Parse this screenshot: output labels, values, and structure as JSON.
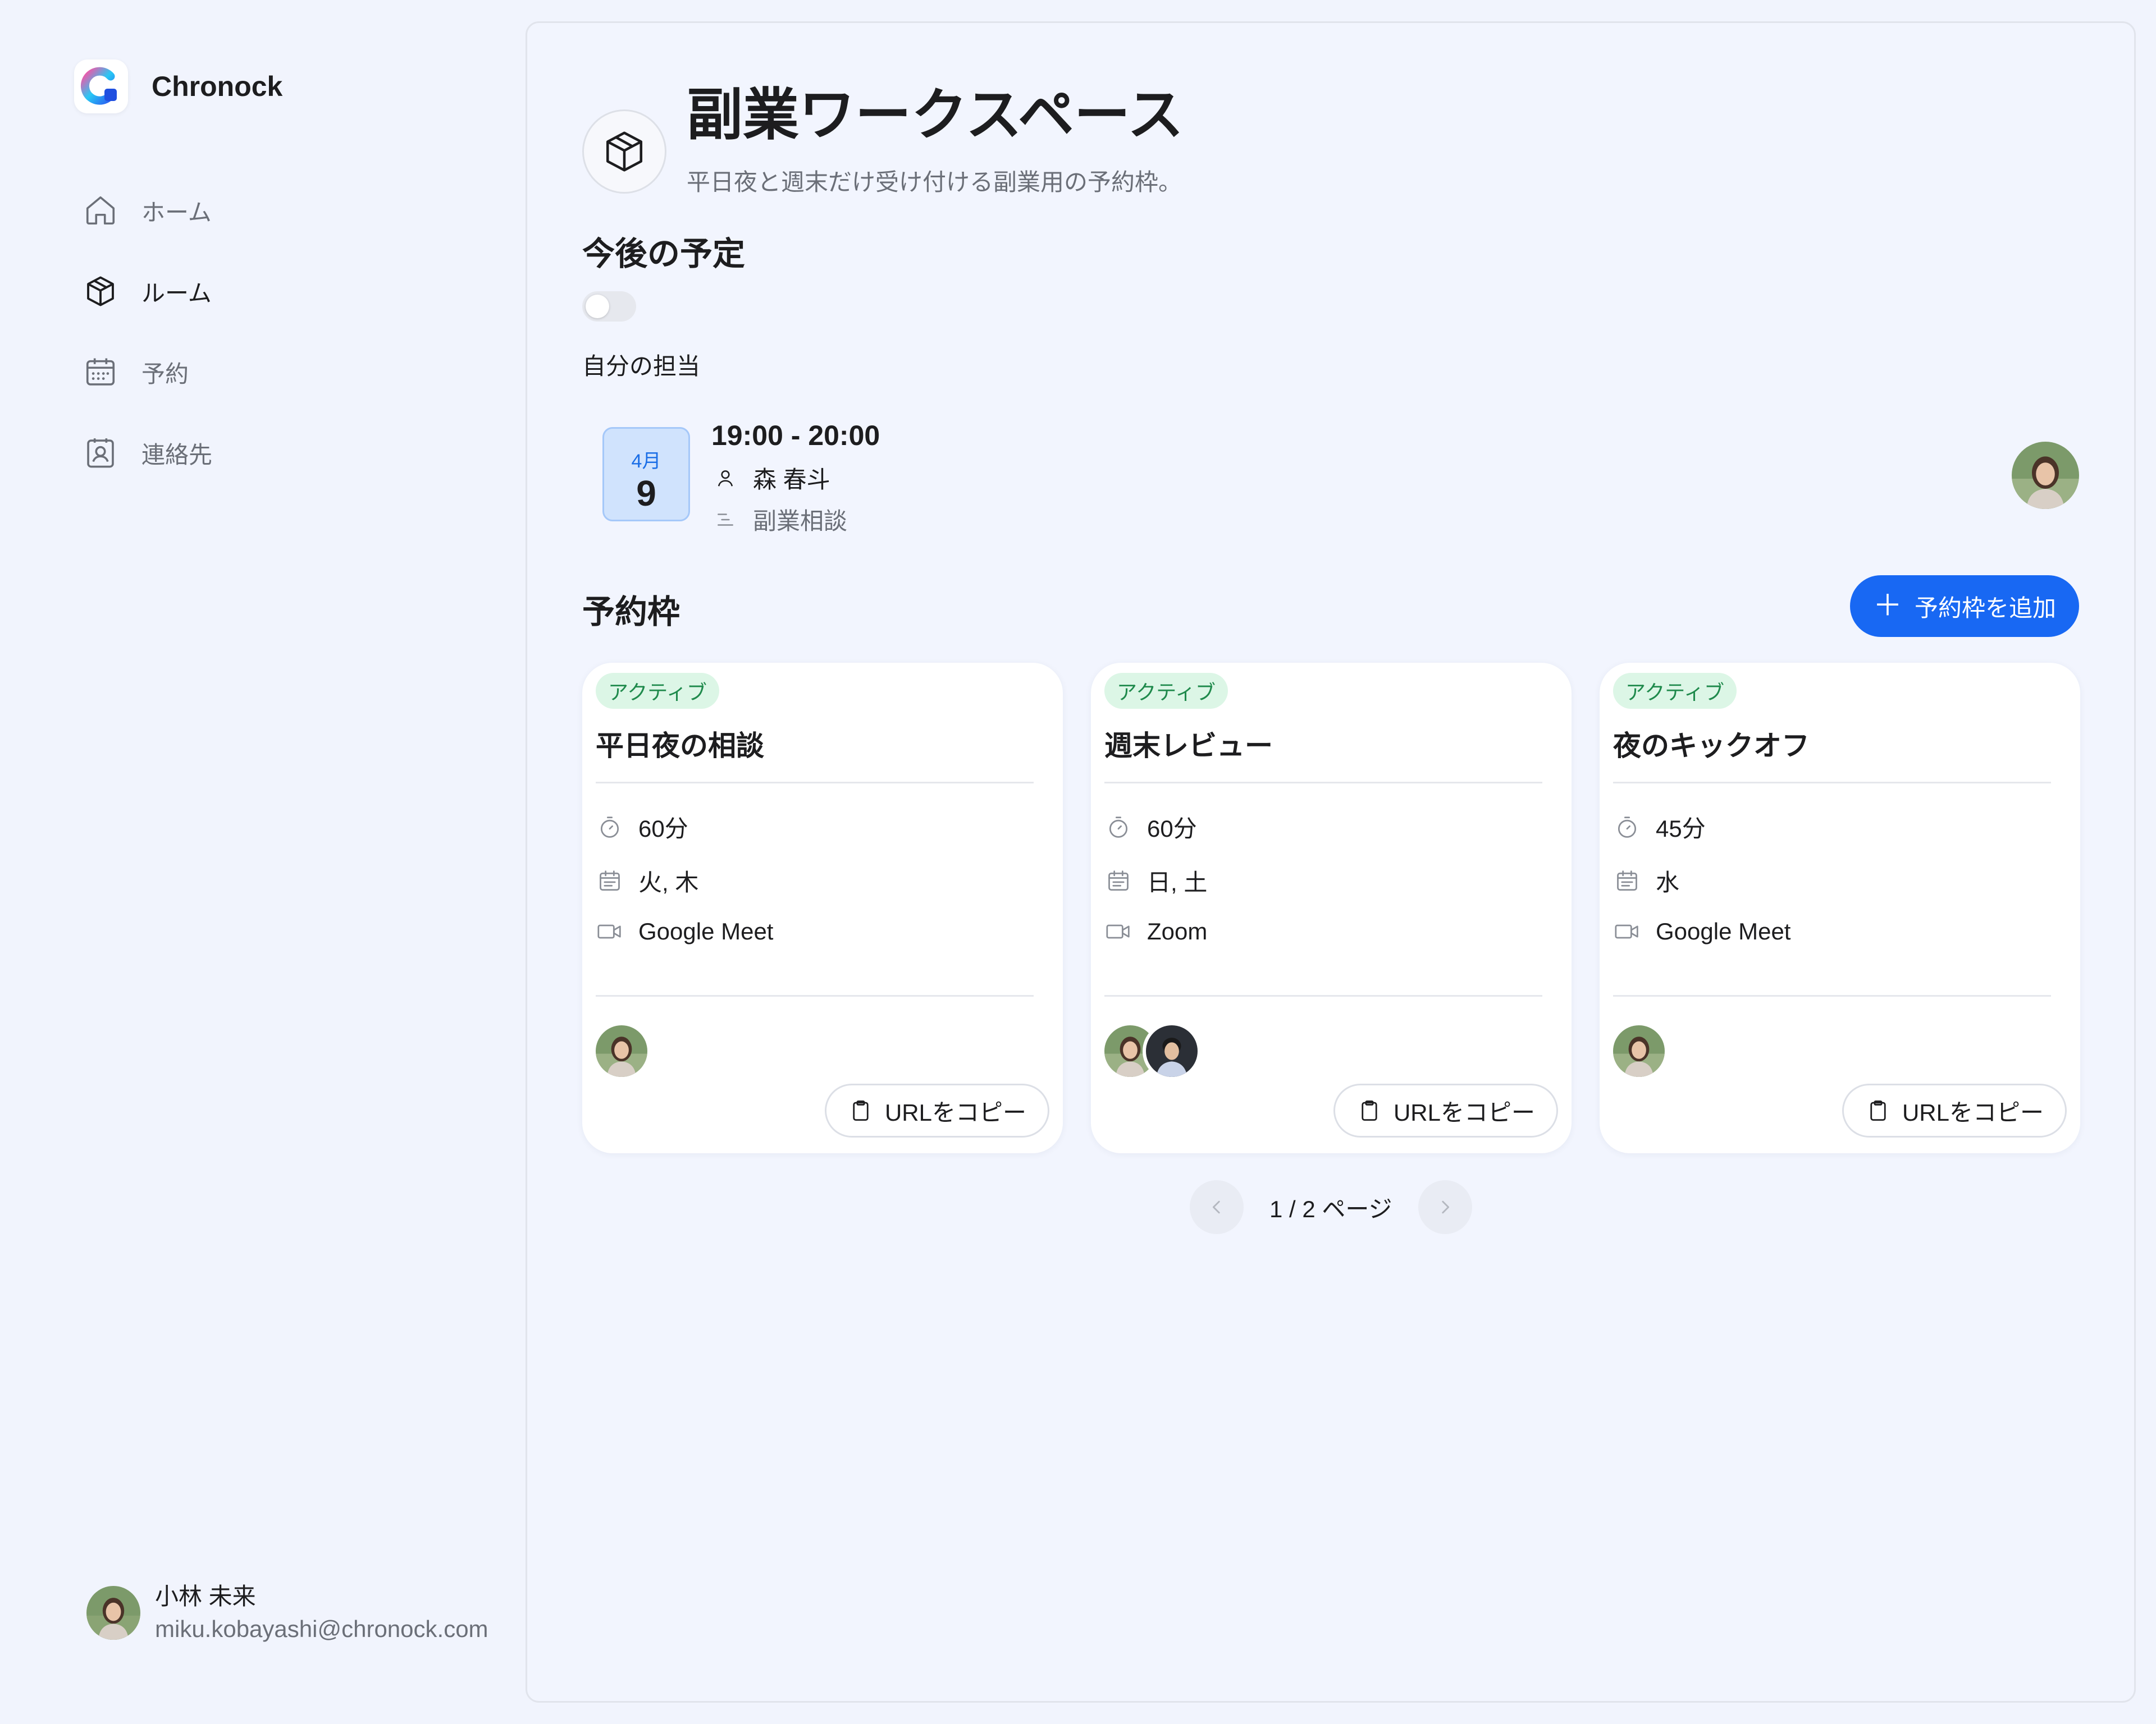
{
  "app": {
    "name": "Chronock"
  },
  "nav": [
    {
      "label": "ホーム",
      "icon": "home-icon"
    },
    {
      "label": "ルーム",
      "icon": "cube-icon"
    },
    {
      "label": "予約",
      "icon": "calendar-icon"
    },
    {
      "label": "連絡先",
      "icon": "contact-icon"
    }
  ],
  "current_user": {
    "name": "小林 未来",
    "email": "miku.kobayashi@chronock.com"
  },
  "room": {
    "title": "副業ワークスペース",
    "description": "平日夜と週末だけ受け付ける副業用の予約枠。"
  },
  "upcoming": {
    "title": "今後の予定",
    "toggle_label": "自分の担当",
    "toggle_on": false,
    "appointment": {
      "month": "4月",
      "day": "9",
      "time": "19:00 - 20:00",
      "person": "森 春斗",
      "subject": "副業相談"
    }
  },
  "slots": {
    "title": "予約枠",
    "add_label": "予約枠を追加",
    "copy_label": "URLをコピー",
    "cards": [
      {
        "badge": "アクティブ",
        "title": "平日夜の相談",
        "duration": "60分",
        "days": "火, 木",
        "tool": "Google Meet"
      },
      {
        "badge": "アクティブ",
        "title": "週末レビュー",
        "duration": "60分",
        "days": "日, 土",
        "tool": "Zoom"
      },
      {
        "badge": "アクティブ",
        "title": "夜のキックオフ",
        "duration": "45分",
        "days": "水",
        "tool": "Google Meet"
      }
    ]
  },
  "pagination": {
    "label": "1 / 2 ページ"
  },
  "colors": {
    "accent": "#1868f3",
    "active_badge_bg": "#dcf6e6",
    "active_badge_text": "#1f8a4c",
    "date_bg": "#d0e3fd"
  }
}
